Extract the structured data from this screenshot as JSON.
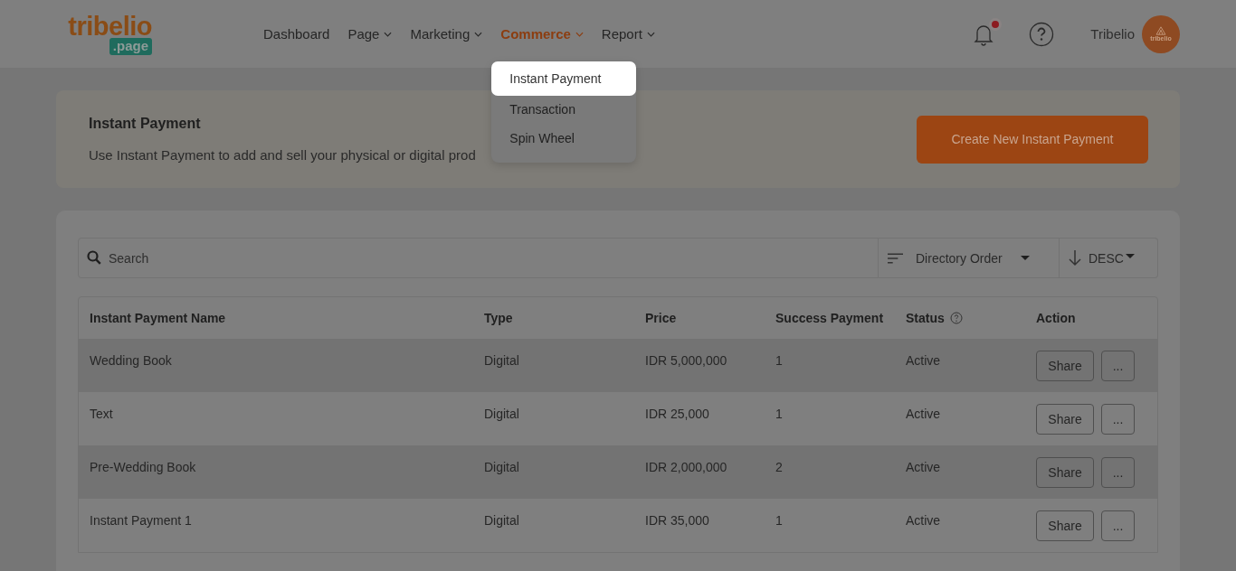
{
  "logo": {
    "word": "tribelio",
    "badge": ".page"
  },
  "nav": [
    {
      "label": "Dashboard",
      "dropdown": false,
      "selected": false
    },
    {
      "label": "Page",
      "dropdown": true,
      "selected": false
    },
    {
      "label": "Marketing",
      "dropdown": true,
      "selected": false
    },
    {
      "label": "Commerce",
      "dropdown": true,
      "selected": true
    },
    {
      "label": "Report",
      "dropdown": true,
      "selected": false
    }
  ],
  "nav_menu": [
    {
      "label": "Instant Payment",
      "selected": true
    },
    {
      "label": "Transaction",
      "selected": false
    },
    {
      "label": "Spin Wheel",
      "selected": false
    }
  ],
  "user": {
    "name": "Tribelio",
    "avatar_text": "tribelio",
    "notification": true
  },
  "intro": {
    "title": "Instant Payment",
    "text": "Use Instant Payment to add and sell your physical or digital prod",
    "button": "Create New Instant Payment"
  },
  "toolbar": {
    "search_placeholder": "Search",
    "sort": "Directory Order",
    "order": "DESC"
  },
  "table": {
    "columns": [
      "Instant Payment Name",
      "Type",
      "Price",
      "Success Payment",
      "Status",
      "Action"
    ],
    "rows": [
      {
        "name": "Wedding Book",
        "type": "Digital",
        "price": "IDR 5,000,000",
        "success": "1",
        "status": "Active",
        "share": "Share",
        "more": "..."
      },
      {
        "name": "Text",
        "type": "Digital",
        "price": "IDR 25,000",
        "success": "1",
        "status": "Active",
        "share": "Share",
        "more": "..."
      },
      {
        "name": "Pre-Wedding Book",
        "type": "Digital",
        "price": "IDR 2,000,000",
        "success": "2",
        "status": "Active",
        "share": "Share",
        "more": "..."
      },
      {
        "name": "Instant Payment 1",
        "type": "Digital",
        "price": "IDR 35,000",
        "success": "1",
        "status": "Active",
        "share": "Share",
        "more": "..."
      }
    ]
  }
}
